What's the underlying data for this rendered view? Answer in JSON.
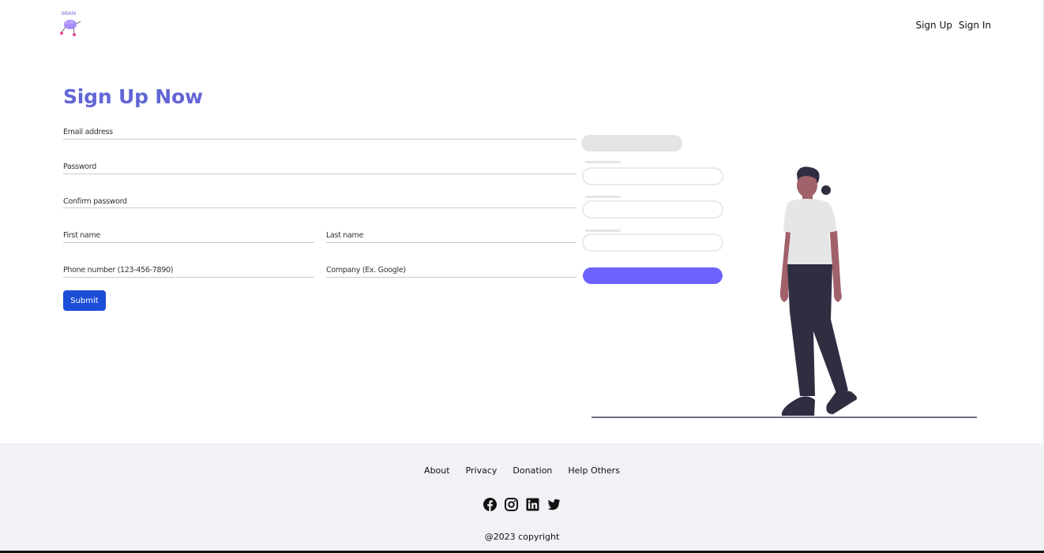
{
  "header": {
    "logo_text": "BRAIN",
    "nav": [
      {
        "label": "Sign Up"
      },
      {
        "label": "Sign In"
      }
    ]
  },
  "form": {
    "title": "Sign Up Now",
    "fields": {
      "email": {
        "placeholder": "Email address",
        "value": ""
      },
      "password": {
        "placeholder": "Password",
        "value": ""
      },
      "confirm_password": {
        "placeholder": "Confirm password",
        "value": ""
      },
      "first_name": {
        "placeholder": "First name",
        "value": ""
      },
      "last_name": {
        "placeholder": "Last name",
        "value": ""
      },
      "phone": {
        "placeholder": "Phone number (123-456-7890)",
        "value": ""
      },
      "company": {
        "placeholder": "Company (Ex. Google)",
        "value": ""
      }
    },
    "submit_label": "Submit"
  },
  "footer": {
    "links": [
      {
        "label": "About"
      },
      {
        "label": "Privacy"
      },
      {
        "label": "Donation"
      },
      {
        "label": "Help Others"
      }
    ],
    "social": [
      {
        "icon": "facebook-icon"
      },
      {
        "icon": "instagram-icon"
      },
      {
        "icon": "linkedin-icon"
      },
      {
        "icon": "twitter-icon"
      }
    ],
    "copyright": "@2023 copyright"
  },
  "colors": {
    "title": "#6366d6",
    "submit": "#1d4ed8",
    "illustration_accent": "#6c63ff",
    "footer_bg": "#f0f2f6"
  }
}
